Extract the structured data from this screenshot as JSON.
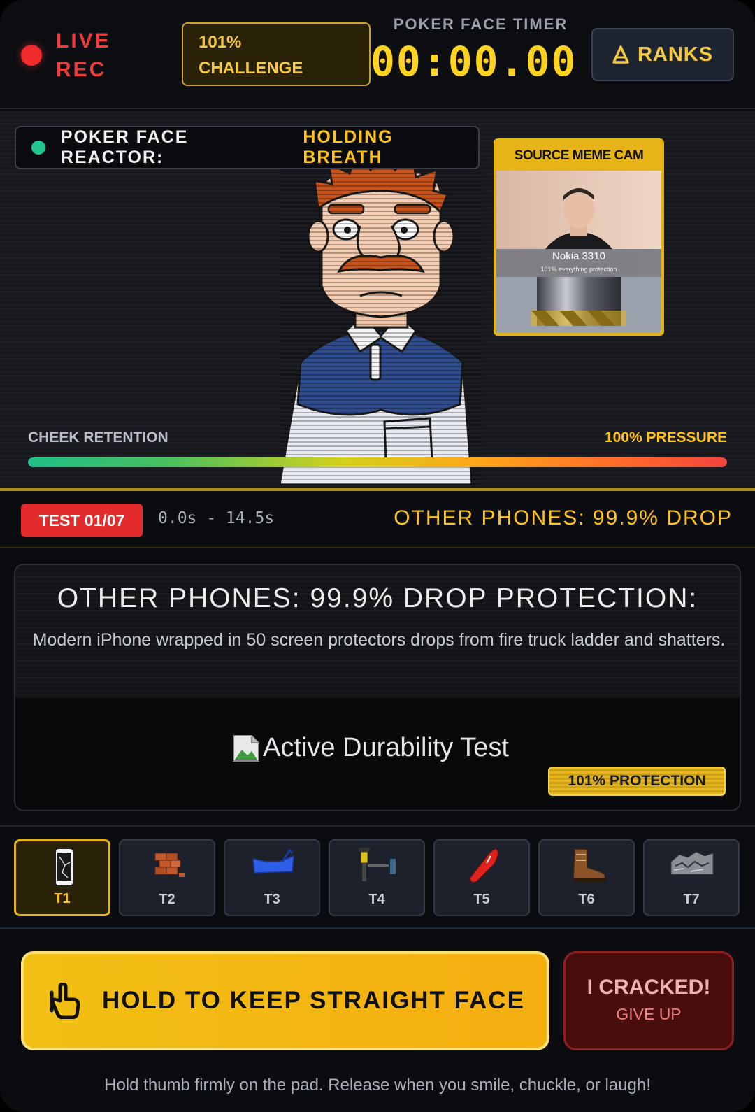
{
  "header": {
    "live_label": "LIVE REC",
    "challenge_label": [
      "101%",
      "CHALLENGE"
    ],
    "timer_label": "POKER FACE TIMER",
    "timer_value": "00:00.00",
    "ranks_label": "RANKS"
  },
  "stage": {
    "reactor_label": "POKER FACE REACTOR:",
    "reactor_state": "HOLDING BREATH",
    "meme_cam": {
      "title": "SOURCE MEME CAM",
      "caption": "Nokia 3310",
      "subcaption": "101% everything protection"
    },
    "cheek_label": "CHEEK RETENTION",
    "pressure_label": "100% PRESSURE",
    "pressure_fraction": 1.0
  },
  "test_row": {
    "badge": "TEST 01/07",
    "range": "0.0s - 14.5s",
    "headline": "OTHER PHONES: 99.9% DROP"
  },
  "info": {
    "title": "OTHER PHONES: 99.9% DROP PROTECTION:",
    "description": "Modern iPhone wrapped in 50 screen protectors drops from fire truck ladder and shatters.",
    "image_alt": "Active Durability Test",
    "protection_badge": "101% PROTECTION"
  },
  "tests": [
    {
      "label": "T1",
      "icon": "cracked-phone-icon",
      "active": true
    },
    {
      "label": "T2",
      "icon": "brick-icon",
      "active": false
    },
    {
      "label": "T3",
      "icon": "blue-car-icon",
      "active": false
    },
    {
      "label": "T4",
      "icon": "hydraulic-press-icon",
      "active": false
    },
    {
      "label": "T5",
      "icon": "red-torch-icon",
      "active": false
    },
    {
      "label": "T6",
      "icon": "boot-icon",
      "active": false
    },
    {
      "label": "T7",
      "icon": "rubble-icon",
      "active": false
    }
  ],
  "actions": {
    "hold_label": "HOLD TO KEEP STRAIGHT FACE",
    "giveup_title": "I CRACKED!",
    "giveup_sub": "GIVE UP",
    "hint": "Hold thumb firmly on the pad. Release when you smile, chuckle, or laugh!"
  },
  "colors": {
    "accent": "#ffc21a",
    "live": "#ef2b2b",
    "danger": "#e32b2b",
    "status_ok": "#22c58f"
  }
}
